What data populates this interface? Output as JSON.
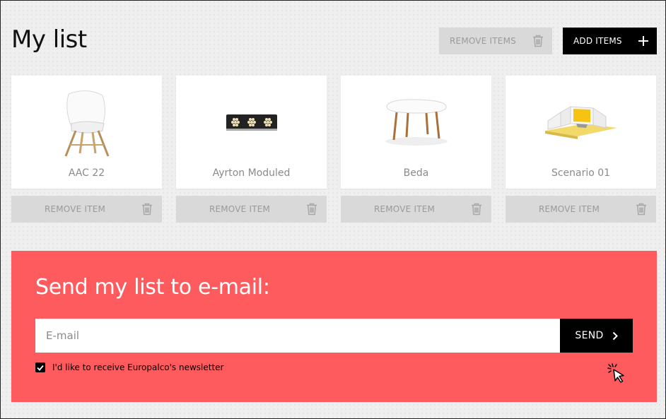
{
  "header": {
    "title": "My list",
    "remove_items_label": "REMOVE ITEMS",
    "add_items_label": "ADD ITEMS"
  },
  "items": [
    {
      "name": "AAC 22",
      "remove_label": "REMOVE ITEM",
      "image": "chair"
    },
    {
      "name": "Ayrton Moduled",
      "remove_label": "REMOVE ITEM",
      "image": "led-panel"
    },
    {
      "name": "Beda",
      "remove_label": "REMOVE ITEM",
      "image": "coffee-table"
    },
    {
      "name": "Scenario 01",
      "remove_label": "REMOVE ITEM",
      "image": "stage-set"
    }
  ],
  "send": {
    "title": "Send my list to e-mail:",
    "email_placeholder": "E-mail",
    "email_value": "",
    "send_label": "SEND",
    "newsletter_label": "I'd like to receive Europalco's newsletter",
    "newsletter_checked": true
  },
  "colors": {
    "panel": "#fe5b5e",
    "button_dark": "#000000",
    "button_disabled": "#d9d9d9"
  },
  "icons": [
    "trash-icon",
    "plus-icon",
    "chevron-right-icon",
    "check-icon",
    "cursor-icon"
  ]
}
